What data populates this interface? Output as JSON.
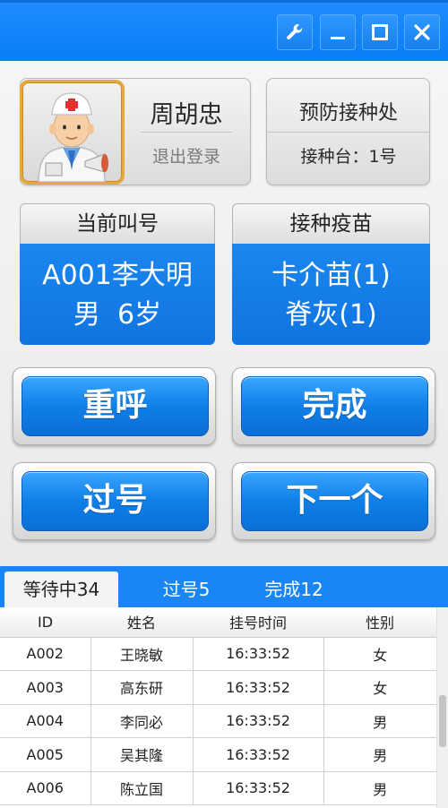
{
  "window": {
    "buttons": [
      {
        "name": "settings",
        "icon": "wrench-icon"
      },
      {
        "name": "minimize",
        "icon": "minimize-icon"
      },
      {
        "name": "maximize",
        "icon": "maximize-icon"
      },
      {
        "name": "close",
        "icon": "close-icon"
      }
    ],
    "accent": "#1a86f5"
  },
  "user": {
    "name": "周胡忠",
    "logout": "退出登录",
    "avatar_icon": "doctor-avatar-icon"
  },
  "station": {
    "title": "预防接种处",
    "desk": "接种台：1号"
  },
  "current_call": {
    "header": "当前叫号",
    "line1": "A001李大明",
    "line2": "男  6岁"
  },
  "vaccine": {
    "header": "接种疫苗",
    "line1": "卡介苗(1)",
    "line2": "脊灰(1)"
  },
  "actions": {
    "recall": "重呼",
    "complete": "完成",
    "skip": "过号",
    "next": "下一个"
  },
  "tabs": [
    {
      "label": "等待中34",
      "active": true
    },
    {
      "label": "过号5",
      "active": false
    },
    {
      "label": "完成12",
      "active": false
    }
  ],
  "table": {
    "columns": [
      "ID",
      "姓名",
      "挂号时间",
      "性别"
    ],
    "rows": [
      [
        "A002",
        "王晓敏",
        "16:33:52",
        "女"
      ],
      [
        "A003",
        "高东研",
        "16:33:52",
        "女"
      ],
      [
        "A004",
        "李同必",
        "16:33:52",
        "男"
      ],
      [
        "A005",
        "吴其隆",
        "16:33:52",
        "男"
      ],
      [
        "A006",
        "陈立国",
        "16:33:52",
        "男"
      ]
    ]
  }
}
